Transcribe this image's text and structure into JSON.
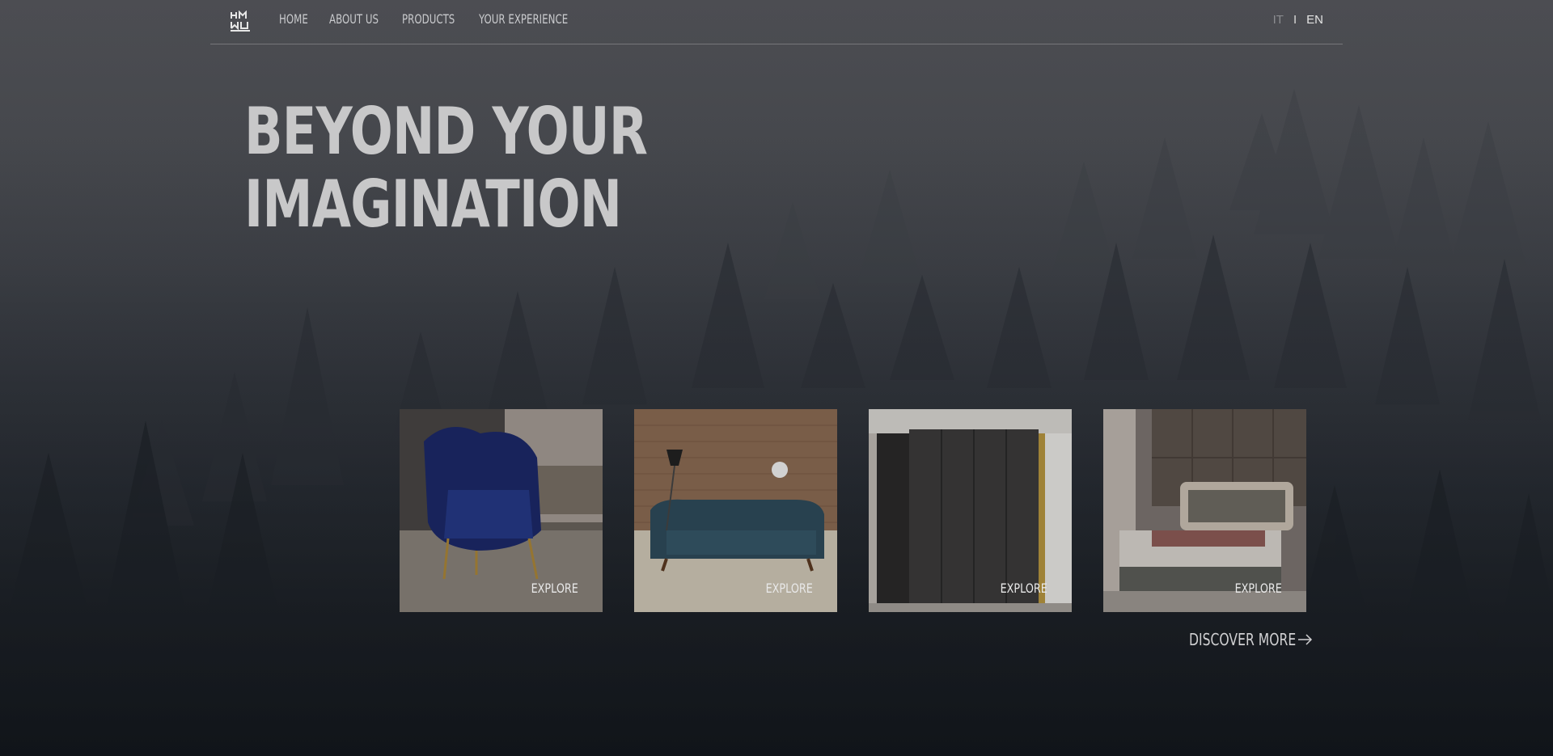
{
  "nav": {
    "items": [
      "HOME",
      "ABOUT US",
      "PRODUCTS",
      "YOUR EXPERIENCE"
    ],
    "lang_it": "IT",
    "lang_sep": "I",
    "lang_en": "EN"
  },
  "hero": {
    "line1": "BEYOND YOUR",
    "line2": "IMAGINATION"
  },
  "cards": [
    {
      "label": "EXPLORE",
      "icon": "armchair-image"
    },
    {
      "label": "EXPLORE",
      "icon": "sofa-image"
    },
    {
      "label": "EXPLORE",
      "icon": "wardrobe-image"
    },
    {
      "label": "EXPLORE",
      "icon": "bed-image"
    }
  ],
  "discover": {
    "label": "DISCOVER MORE",
    "icon": "arrow-right-icon"
  },
  "colors": {
    "text": "#c8c8c9",
    "accent": "#e0e0e0"
  }
}
